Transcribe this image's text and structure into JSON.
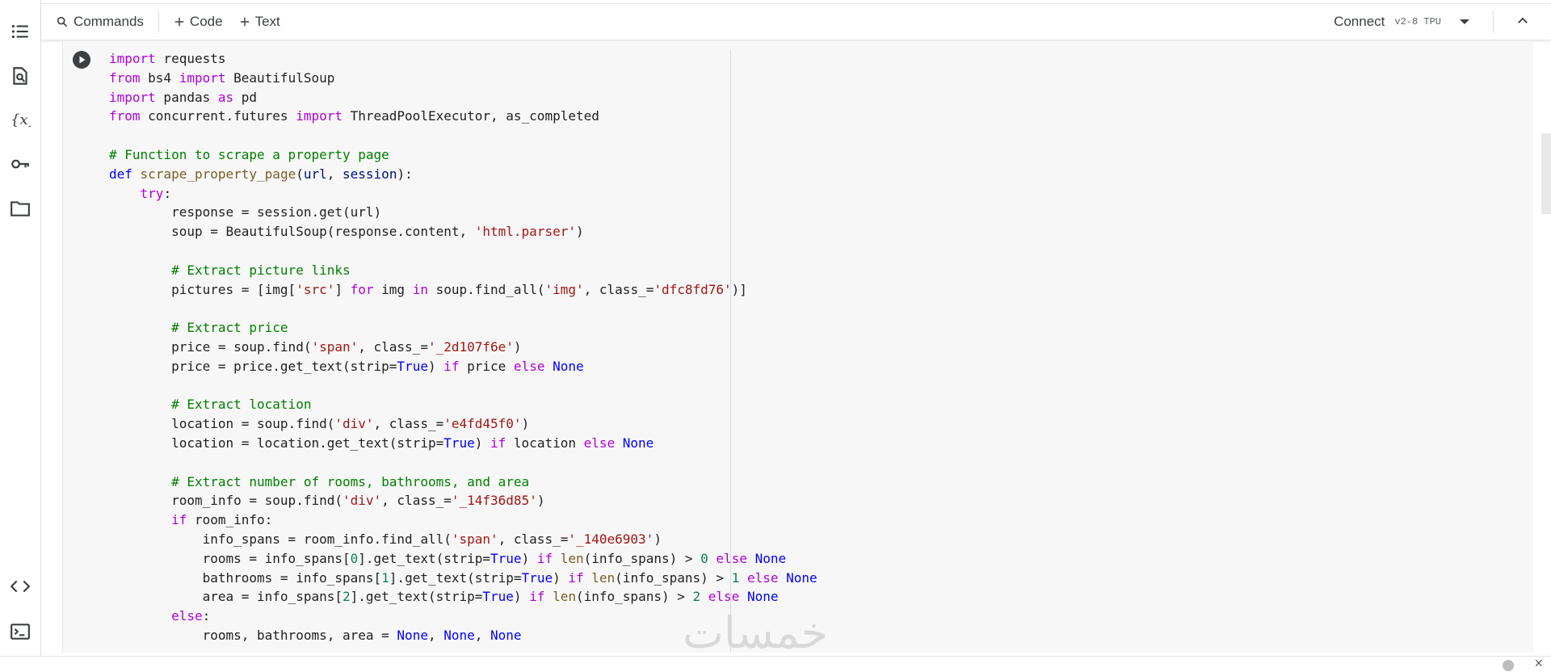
{
  "toolbar": {
    "commands": "Commands",
    "add_code": "Code",
    "add_text": "Text",
    "connect": "Connect",
    "runtime": "v2-8 TPU"
  },
  "sidebar": {
    "icons": [
      "table-of-contents-icon",
      "find-replace-icon",
      "variables-icon",
      "secrets-key-icon",
      "files-folder-icon",
      "code-snippets-icon",
      "terminal-icon"
    ]
  },
  "code_cell": {
    "lines": [
      "import requests",
      "from bs4 import BeautifulSoup",
      "import pandas as pd",
      "from concurrent.futures import ThreadPoolExecutor, as_completed",
      "",
      "# Function to scrape a property page",
      "def scrape_property_page(url, session):",
      "    try:",
      "        response = session.get(url)",
      "        soup = BeautifulSoup(response.content, 'html.parser')",
      "",
      "        # Extract picture links",
      "        pictures = [img['src'] for img in soup.find_all('img', class_='dfc8fd76')]",
      "",
      "        # Extract price",
      "        price = soup.find('span', class_='_2d107f6e')",
      "        price = price.get_text(strip=True) if price else None",
      "",
      "        # Extract location",
      "        location = soup.find('div', class_='e4fd45f0')",
      "        location = location.get_text(strip=True) if location else None",
      "",
      "        # Extract number of rooms, bathrooms, and area",
      "        room_info = soup.find('div', class_='_14f36d85')",
      "        if room_info:",
      "            info_spans = room_info.find_all('span', class_='_140e6903')",
      "            rooms = info_spans[0].get_text(strip=True) if len(info_spans) > 0 else None",
      "            bathrooms = info_spans[1].get_text(strip=True) if len(info_spans) > 1 else None",
      "            area = info_spans[2].get_text(strip=True) if len(info_spans) > 2 else None",
      "        else:",
      "            rooms, bathrooms, area = None, None, None"
    ]
  },
  "watermark": "خمسات"
}
